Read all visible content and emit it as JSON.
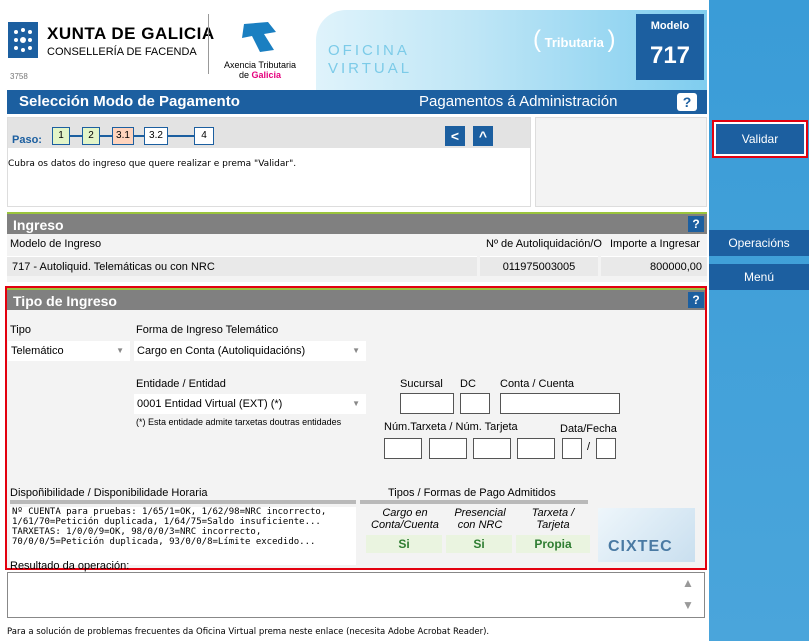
{
  "header": {
    "xunta_title": "XUNTA DE GALICIA",
    "xunta_subtitle": "CONSELLERÍA DE FACENDA",
    "xunta_number": "3758",
    "atg_line1": "Axencia Tributaria",
    "atg_de": "de ",
    "atg_galicia": "Galicia",
    "oficina": "OFICINA",
    "virtual": "VIRTUAL",
    "tributaria": "Tributaria",
    "modelo_label": "Modelo",
    "modelo_number": "717"
  },
  "sidebar": {
    "validar": "Validar",
    "operacions": "Operacións",
    "menu": "Menú"
  },
  "titlebar": {
    "left": "Selección Modo de Pagamento",
    "right": "Pagamentos á Administración",
    "help": "?"
  },
  "steps": {
    "label": "Paso:",
    "items": [
      "1",
      "2",
      "3.1",
      "3.2",
      "4"
    ],
    "instruction": "Cubra os datos do ingreso que quere realizar e prema \"Validar\"."
  },
  "ingreso": {
    "title": "Ingreso",
    "help": "?",
    "col_modelo": "Modelo de Ingreso",
    "col_autoliq": "Nº de Autoliquidación/O",
    "col_importe": "Importe a Ingresar",
    "modelo_value": "717 - Autoliquid. Telemáticas ou con NRC",
    "autoliq_value": "011975003005",
    "importe_value": "800000,00"
  },
  "tipo": {
    "title": "Tipo de Ingreso",
    "help": "?",
    "tipo_label": "Tipo",
    "tipo_value": "Telemático",
    "forma_label": "Forma de Ingreso Telemático",
    "forma_value": "Cargo en Conta (Autoliquidacións)",
    "entidade_label": "Entidade / Entidad",
    "entidade_value": "0001  Entidad Virtual (EXT) (*)",
    "entidade_note": "(*) Esta entidade admite tarxetas doutras entidades",
    "sucursal_label": "Sucursal",
    "dc_label": "DC",
    "conta_label": "Conta / Cuenta",
    "tarxeta_label": "Núm.Tarxeta / Núm. Tarjeta",
    "data_label": "Data/Fecha",
    "date_sep": "/",
    "disp_label": "Dispoñibilidade / Disponibilidade Horaria",
    "disp_lines": [
      "Nº CUENTA para pruebas: 1/65/1=OK, 1/62/98=NRC incorrecto,",
      "1/61/70=Petición duplicada, 1/64/75=Saldo insuficiente...",
      "TARXETAS: 1/0/0/9=OK, 98/0/0/3=NRC incorrecto,",
      "70/0/0/5=Petición duplicada, 93/0/0/8=Límite excedido..."
    ],
    "tipos_label": "Tipos / Formas de Pago Admitidos",
    "pay_cargo_l1": "Cargo en",
    "pay_cargo_l2": "Conta/Cuenta",
    "pay_pres_l1": "Presencial",
    "pay_pres_l2": "con NRC",
    "pay_tarx_l1": "Tarxeta /",
    "pay_tarx_l2": "Tarjeta",
    "pay_cargo_v": "Si",
    "pay_pres_v": "Si",
    "pay_tarx_v": "Propia",
    "cixtec": "CIXTEC",
    "resultado_label": "Resultado da operación:"
  },
  "footer": "Para a solución de problemas frecuentes da Oficina Virtual prema neste enlace (necesita Adobe Acrobat Reader).",
  "colors": {
    "brand_blue": "#1c5fa0",
    "highlight_red": "#e3000f",
    "ok_green": "#2f7d32"
  }
}
